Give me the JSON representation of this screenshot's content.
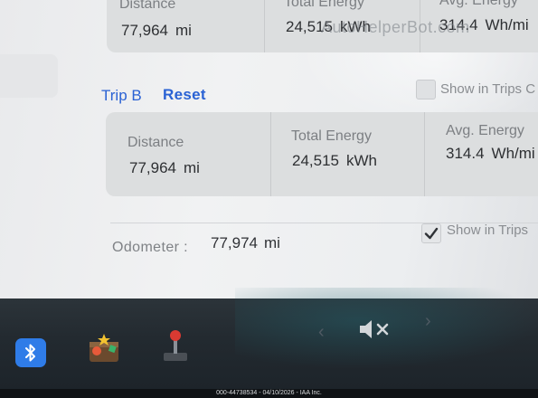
{
  "trip_a": {
    "distance_label": "Distance",
    "distance_value": "77,964",
    "distance_unit": "mi",
    "energy_label": "Total Energy",
    "energy_value": "24,515",
    "energy_unit": "kWh",
    "avg_label": "Avg. Energy",
    "avg_value": "314.4",
    "avg_unit": "Wh/mi"
  },
  "trip_b": {
    "title": "Trip B",
    "reset_label": "Reset",
    "show_in_trips_label": "Show in Trips C",
    "show_in_trips_checked": false,
    "distance_label": "Distance",
    "distance_value": "77,964",
    "distance_unit": "mi",
    "energy_label": "Total Energy",
    "energy_value": "24,515",
    "energy_unit": "kWh",
    "avg_label": "Avg. Energy",
    "avg_value": "314.4",
    "avg_unit": "Wh/mi"
  },
  "odometer": {
    "label": "Odometer :",
    "value": "77,974",
    "unit": "mi",
    "show_in_trips_label": "Show in Trips",
    "show_in_trips_checked": true
  },
  "watermark": "AutoHelperBot.com",
  "footer_caption": "000-44738534 - 04/10/2026 - IAA Inc.",
  "taskbar": {
    "icons": [
      "bluetooth-icon",
      "toybox-icon",
      "joystick-icon",
      "chevron-left-icon",
      "mute-icon",
      "chevron-right-icon"
    ],
    "bluetooth_color": "#2f7ce8"
  },
  "colors": {
    "link": "#2a62d4",
    "card": "#dcdedf",
    "taskbar": "#232a30"
  }
}
